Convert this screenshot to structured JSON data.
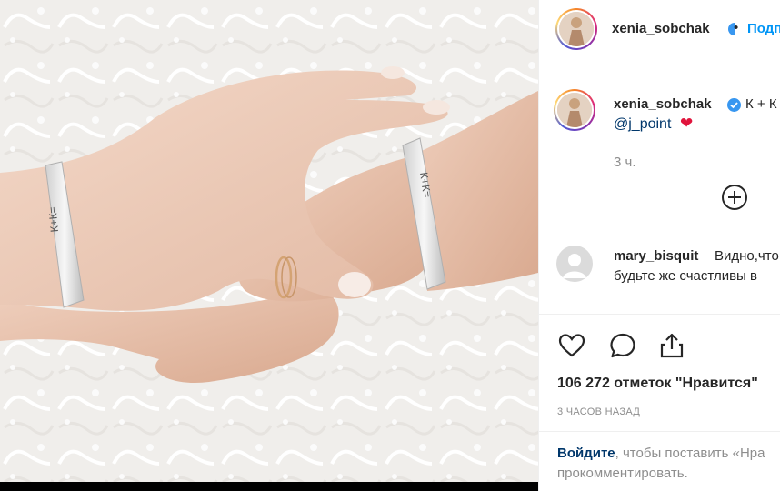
{
  "post": {
    "author": "xenia_sobchak",
    "follow_label": "Подписаться",
    "caption": {
      "text": "К + К",
      "mention": "@j_point",
      "emoji": "❤️",
      "time_ago": "3 ч."
    },
    "photo_engraving": {
      "left_bracelet": "К+К=",
      "right_bracelet": "К+К="
    },
    "comments": [
      {
        "username": "mary_bisquit",
        "text_line1": "Видно,что",
        "text_line2": "будьте же счастливы в"
      }
    ],
    "likes_text": "106 272 отметок \"Нравится\"",
    "posted_label": "3 ЧАСОВ НАЗАД",
    "login_prompt": {
      "link": "Войдите",
      "rest_line1": ", чтобы поставить «Нра",
      "line2": "прокомментировать."
    }
  },
  "icons": {
    "verified": "verified-badge-icon",
    "add": "plus-circle-icon",
    "like": "heart-outline-icon",
    "comment": "speech-bubble-icon",
    "share": "share-upload-icon"
  },
  "colors": {
    "accent_blue": "#0095f6",
    "mention_blue": "#00376b",
    "secondary_text": "#8e8e8e",
    "verified_blue": "#3897f0",
    "heart_red": "#e0143c"
  }
}
